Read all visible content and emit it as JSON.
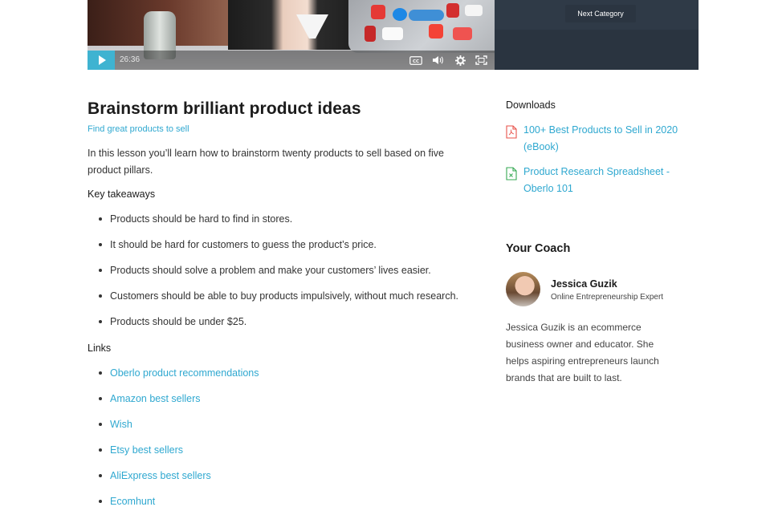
{
  "video": {
    "time": "26:36",
    "controls": [
      "closed-captions",
      "volume",
      "settings",
      "fullscreen"
    ]
  },
  "category_panel": {
    "next_label": "Next Category"
  },
  "lesson": {
    "title": "Brainstorm brilliant product ideas",
    "subtitle": "Find great products to sell",
    "intro": "In this lesson you’ll learn how to brainstorm twenty products to sell based on five product pillars.",
    "takeaways_heading": "Key takeaways",
    "takeaways": [
      "Products should be hard to find in stores.",
      "It should be hard for customers to guess the product’s price.",
      "Products should solve a problem and make your customers’ lives easier.",
      "Customers should be able to buy products impulsively, without much research.",
      "Products should be under $25."
    ],
    "links_heading": "Links",
    "links": [
      "Oberlo product recommendations",
      "Amazon best sellers",
      "Wish",
      "Etsy best sellers",
      "AliExpress best sellers",
      "Ecomhunt"
    ]
  },
  "sidebar": {
    "downloads_heading": "Downloads",
    "downloads": [
      {
        "title": "100+ Best Products to Sell in 2020 (eBook)",
        "icon": "pdf-file-icon",
        "color": "#e8524a"
      },
      {
        "title": "Product Research Spreadsheet - Oberlo 101",
        "icon": "spreadsheet-file-icon",
        "color": "#35a853"
      }
    ],
    "coach_heading": "Your Coach",
    "coach": {
      "name": "Jessica Guzik",
      "role": "Online Entrepreneurship Expert",
      "bio": "Jessica Guzik is an ecommerce business owner and educator. She helps aspiring entrepreneurs launch brands that are built to last."
    }
  },
  "colors": {
    "accent": "#2fa8d0",
    "play_button": "#3fb3d1",
    "panel": "#2f3a47"
  }
}
